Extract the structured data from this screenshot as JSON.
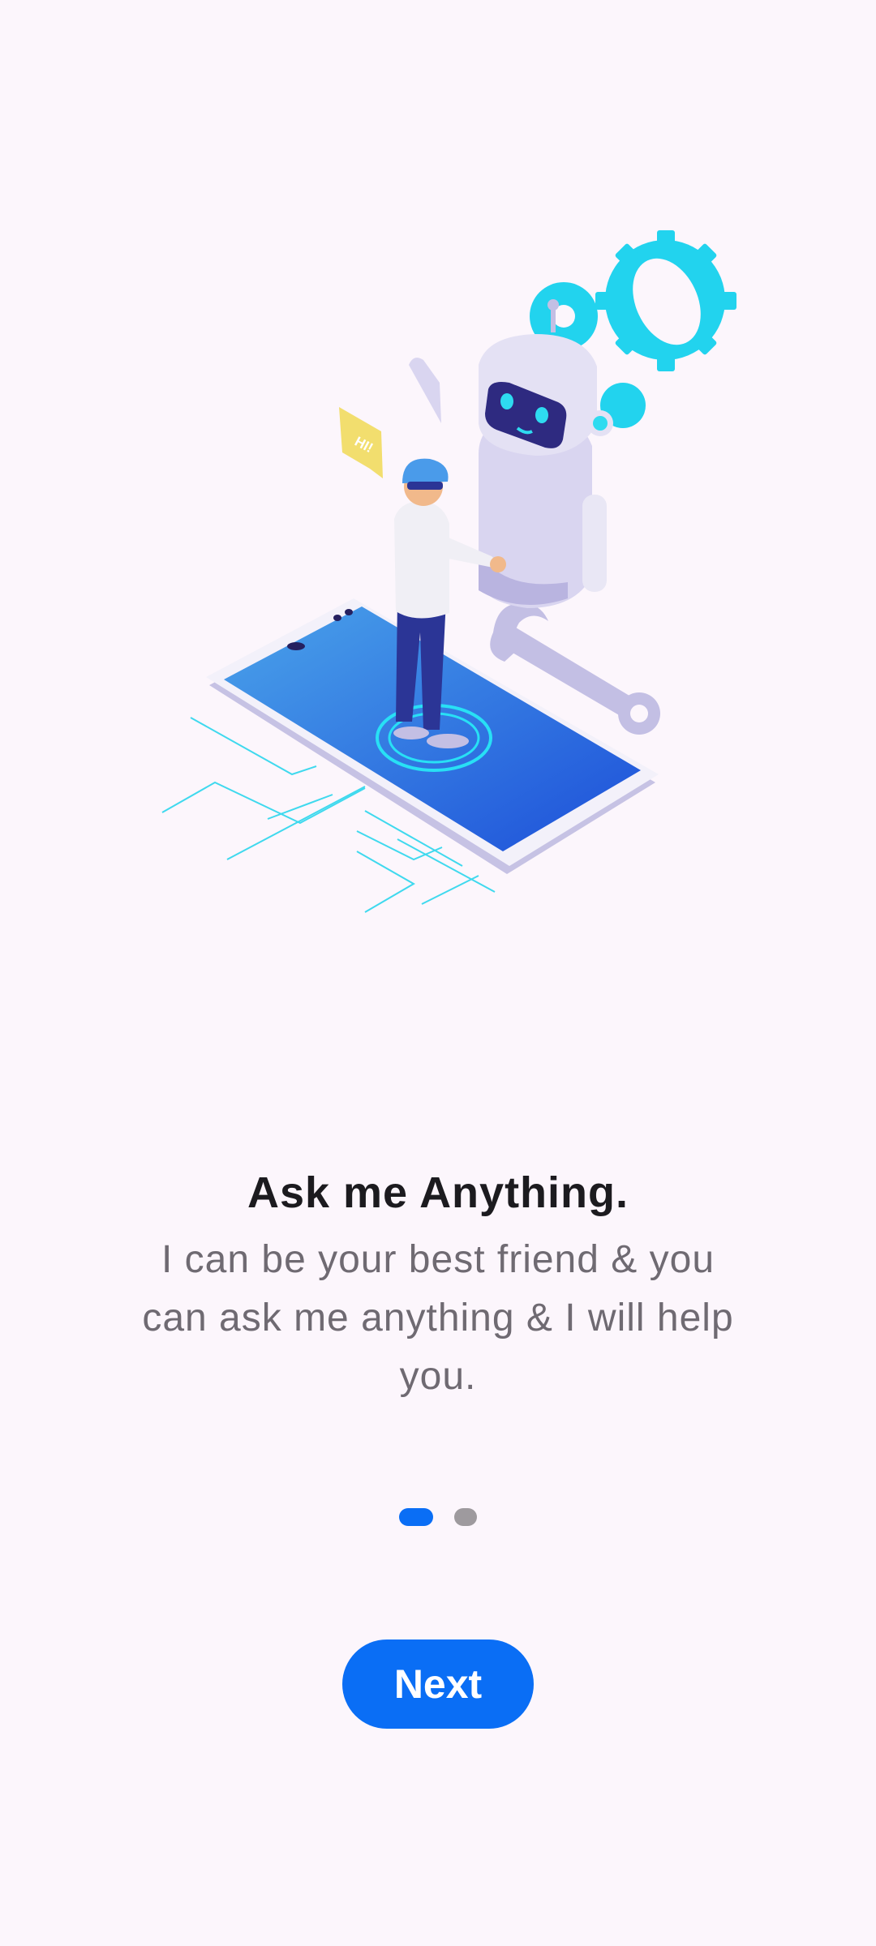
{
  "onboarding": {
    "title": "Ask me Anything.",
    "subtitle": "I can be your best friend & you can ask me anything & I will help you.",
    "bubble_text": "HI!",
    "next_label": "Next",
    "page_indicator": {
      "total": 2,
      "current": 1
    },
    "colors": {
      "background": "#FCF6FC",
      "accent": "#0A6EF5",
      "inactive_dot": "#9E9A9E",
      "gear": "#22D3EE",
      "robot": "#D9D5F0"
    }
  }
}
